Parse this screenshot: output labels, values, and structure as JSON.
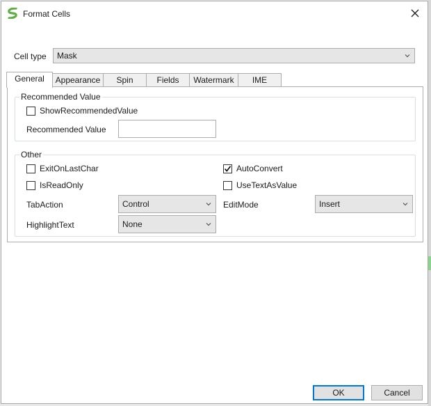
{
  "window": {
    "title": "Format Cells",
    "icon": "spread-logo-icon"
  },
  "cell_type": {
    "label": "Cell type",
    "value": "Mask"
  },
  "tabs": [
    {
      "label": "General",
      "active": true
    },
    {
      "label": "Appearance",
      "active": false
    },
    {
      "label": "Spin",
      "active": false
    },
    {
      "label": "Fields",
      "active": false
    },
    {
      "label": "Watermark",
      "active": false
    },
    {
      "label": "IME",
      "active": false
    }
  ],
  "recommended_group": {
    "title": "Recommended Value",
    "show_checkbox": {
      "label": "ShowRecommendedValue",
      "checked": false
    },
    "value_label": "Recommended Value",
    "value": ""
  },
  "other_group": {
    "title": "Other",
    "exit_on_last_char": {
      "label": "ExitOnLastChar",
      "checked": false
    },
    "is_read_only": {
      "label": "IsReadOnly",
      "checked": false
    },
    "auto_convert": {
      "label": "AutoConvert",
      "checked": true
    },
    "use_text_as_value": {
      "label": "UseTextAsValue",
      "checked": false
    },
    "tab_action": {
      "label": "TabAction",
      "value": "Control"
    },
    "edit_mode": {
      "label": "EditMode",
      "value": "Insert"
    },
    "highlight_text": {
      "label": "HighlightText",
      "value": "None"
    }
  },
  "buttons": {
    "ok": "OK",
    "cancel": "Cancel"
  },
  "colors": {
    "logo_green": "#5fae45",
    "default_button_border": "#0078d7",
    "check_mark": "#000000"
  }
}
